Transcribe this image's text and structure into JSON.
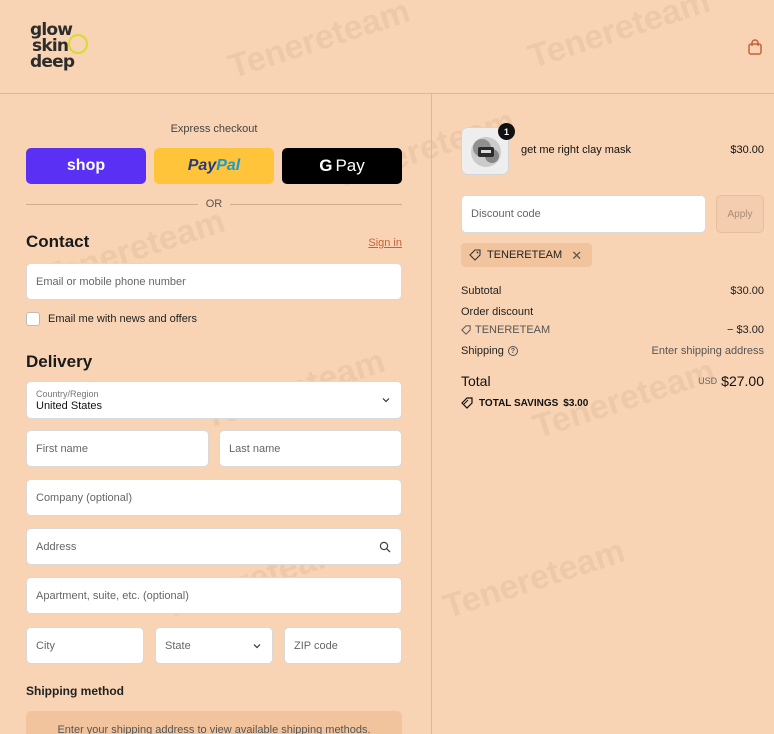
{
  "brand": {
    "logo_line1": "glow",
    "logo_line2": "skin",
    "logo_line3": "deep"
  },
  "express": {
    "title": "Express checkout",
    "shop_label": "shop",
    "paypal_label_a": "Pay",
    "paypal_label_b": "Pal",
    "gpay_g": "G",
    "gpay_label": "Pay",
    "or_label": "OR"
  },
  "contact": {
    "title": "Contact",
    "sign_in": "Sign in",
    "email_placeholder": "Email or mobile phone number",
    "newsletter_label": "Email me with news and offers"
  },
  "delivery": {
    "title": "Delivery",
    "country_label": "Country/Region",
    "country_value": "United States",
    "first_name": "First name",
    "last_name": "Last name",
    "company": "Company (optional)",
    "address": "Address",
    "apartment": "Apartment, suite, etc. (optional)",
    "city": "City",
    "state": "State",
    "zip": "ZIP code"
  },
  "shipping_method": {
    "title": "Shipping method",
    "message": "Enter your shipping address to view available shipping methods."
  },
  "order": {
    "item_qty": "1",
    "item_name": "get me right clay mask",
    "item_price": "$30.00",
    "discount_placeholder": "Discount code",
    "apply_label": "Apply",
    "applied_code": "TENERETEAM",
    "subtotal_label": "Subtotal",
    "subtotal_value": "$30.00",
    "order_discount_label": "Order discount",
    "discount_code": "TENERETEAM",
    "discount_value": "− $3.00",
    "shipping_label": "Shipping",
    "shipping_value": "Enter shipping address",
    "total_label": "Total",
    "currency": "USD",
    "total_value": "$27.00",
    "savings_label": "TOTAL SAVINGS",
    "savings_value": "$3.00"
  },
  "watermark": "Tenereteam",
  "colors": {
    "shop": "#5a31f4",
    "paypal": "#ffc439",
    "gpay": "#000000",
    "page_bg": "#f9d4b4",
    "accent": "#c7613b"
  }
}
